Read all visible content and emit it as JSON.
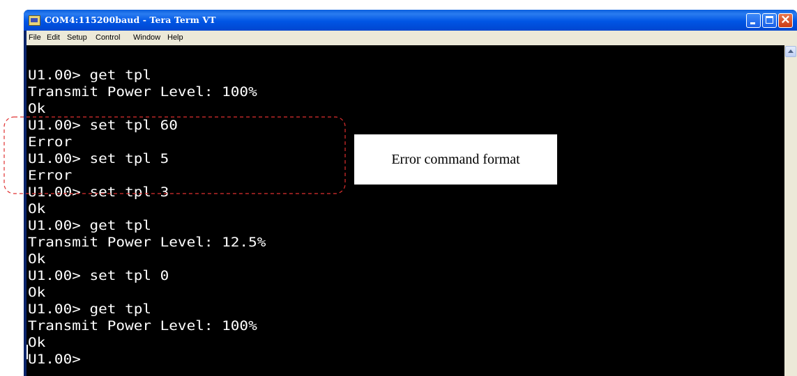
{
  "window": {
    "title": "COM4:115200baud - Tera Term VT",
    "controls": {
      "minimize": "minimize",
      "maximize": "maximize",
      "close": "close"
    }
  },
  "menu": {
    "items": [
      "File",
      "Edit",
      "Setup",
      "Control",
      "Window",
      "Help"
    ]
  },
  "terminal": {
    "lines": [
      "U1.00> get tpl",
      "Transmit Power Level: 100%",
      "Ok",
      "U1.00> set tpl 60",
      "Error",
      "U1.00> set tpl 5",
      "Error",
      "U1.00> set tpl 3",
      "Ok",
      "U1.00> get tpl",
      "Transmit Power Level: 12.5%",
      "Ok",
      "U1.00> set tpl 0",
      "Ok",
      "U1.00> get tpl",
      "Transmit Power Level: 100%",
      "Ok",
      "U1.00>"
    ]
  },
  "annotation": {
    "label": "Error command format",
    "border_color": "#e03030"
  },
  "icons": {
    "app": "tera-term-icon",
    "scroll_up": "scroll-up-arrow-icon"
  }
}
